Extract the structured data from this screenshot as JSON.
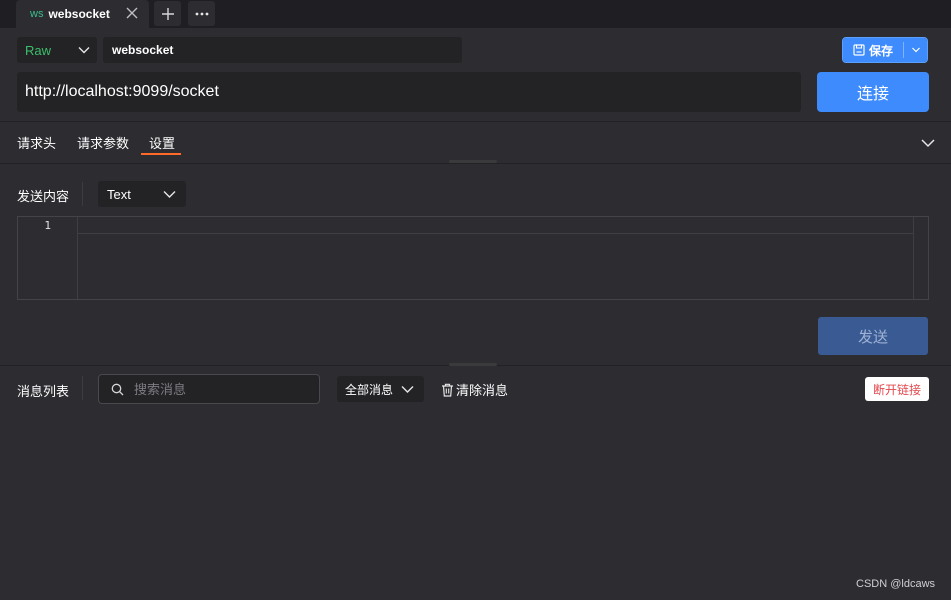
{
  "tab": {
    "prefix": "ws",
    "title": "websocket"
  },
  "tabbar_icons": [
    "close-icon",
    "plus-icon",
    "more-icon"
  ],
  "request": {
    "mode": "Raw",
    "name": "websocket",
    "url": "http://localhost:9099/socket",
    "save_label": "保存",
    "connect_label": "连接"
  },
  "subtabs": [
    {
      "label": "请求头"
    },
    {
      "label": "请求参数"
    },
    {
      "label": "设置"
    }
  ],
  "active_subtab": "设置",
  "send": {
    "label": "发送内容",
    "type": "Text",
    "line_numbers": [
      "1"
    ],
    "button_label": "发送"
  },
  "messages": {
    "label": "消息列表",
    "search_placeholder": "搜索消息",
    "filter": "全部消息",
    "clear_label": "清除消息",
    "disconnect_label": "断开链接"
  },
  "watermark": "CSDN @ldcaws",
  "colors": {
    "accent_blue": "#3d8bfd",
    "active_tab_underline": "#ff6a2b",
    "raw_green": "#3bbf6a",
    "danger_red": "#e5484d",
    "background": "#2c2c31"
  }
}
